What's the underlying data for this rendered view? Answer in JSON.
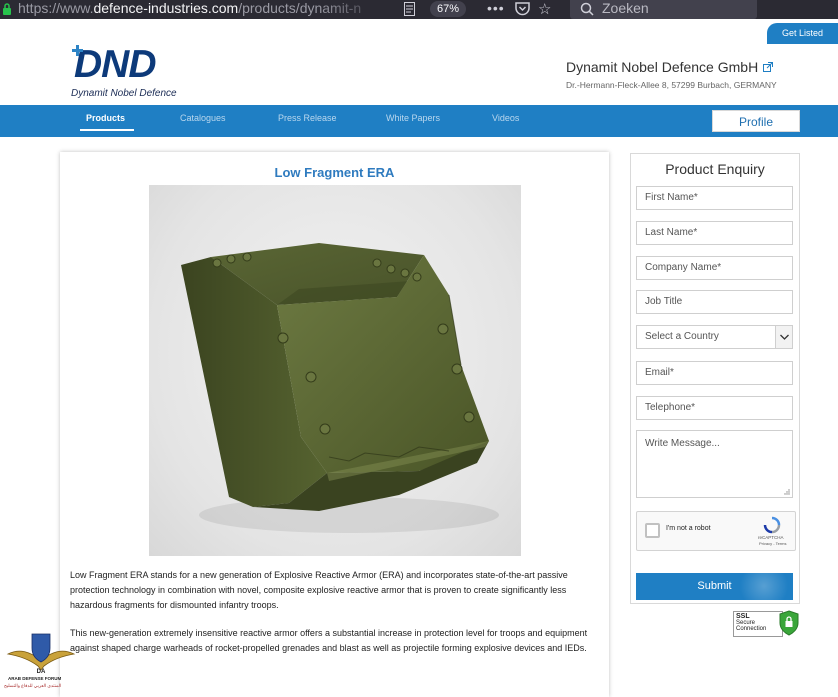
{
  "browser": {
    "url_prefix": "https://www.",
    "url_domain": "defence-industries.com",
    "url_path": "/products/dynamit-n",
    "zoom": "67%",
    "more": "•••",
    "search_placeholder": "Zoeken"
  },
  "header": {
    "get_listed": "Get Listed",
    "logo_text": "DND",
    "logo_subtitle": "Dynamit Nobel Defence",
    "company_name": "Dynamit Nobel Defence GmbH",
    "company_address": "Dr.-Hermann-Fleck-Allee 8, 57299 Burbach, GERMANY"
  },
  "nav": {
    "items": [
      "Products",
      "Catalogues",
      "Press Release",
      "White Papers",
      "Videos"
    ],
    "active": "Products",
    "profile": "Profile"
  },
  "product": {
    "title": "Low Fragment ERA",
    "paragraphs": [
      "Low Fragment ERA stands for a new generation of Explosive Reactive Armor (ERA) and incorporates state-of-the-art passive protection technology in combination with novel, composite explosive reactive armor that is proven to create significantly less hazardous fragments for dismounted infantry troops.",
      "This new-generation extremely insensitive reactive armor offers a substantial increase in protection level for troops and equipment against shaped charge warheads of rocket-propelled grenades and blast as well as projectile forming explosive devices and IEDs."
    ]
  },
  "enquiry": {
    "title": "Product Enquiry",
    "first_name": "First Name*",
    "last_name": "Last Name*",
    "company_name": "Company Name*",
    "job_title": "Job Title",
    "country": "Select a Country",
    "email": "Email*",
    "telephone": "Telephone*",
    "message": "Write Message...",
    "captcha_label": "I'm not a robot",
    "captcha_brand": "reCAPTCHA",
    "captcha_terms": "Privacy - Terms",
    "submit": "Submit"
  },
  "ssl_badge": {
    "line1": "SSL",
    "line2": "Secure",
    "line3": "Connection"
  },
  "watermark": {
    "line1": "ARAB DEFENSE FORUM",
    "line2": "المنتدى العربي للدفاع والتسليح"
  },
  "colors": {
    "brand_blue": "#1f7fc4",
    "logo_navy": "#0d3a7a",
    "title_blue": "#2f7bbf",
    "armor_green": "#4f5a2c"
  }
}
